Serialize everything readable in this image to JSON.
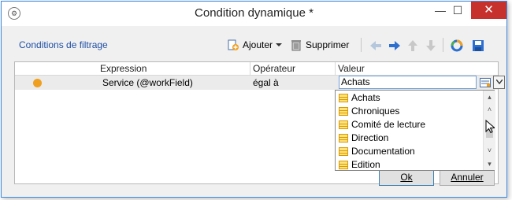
{
  "window": {
    "title": "Condition dynamique *",
    "app_icon": "window-icon",
    "minimize_glyph": "—",
    "maximize_glyph": "☐",
    "close_glyph": "✕"
  },
  "toolbar": {
    "section_label": "Conditions de filtrage",
    "add_label": "Ajouter",
    "delete_label": "Supprimer"
  },
  "grid": {
    "columns": [
      "Expression",
      "Opérateur",
      "Valeur"
    ],
    "rows": [
      {
        "expression": "Service (@workField)",
        "operator": "égal à",
        "value": "Achats"
      }
    ]
  },
  "dropdown": {
    "items": [
      "Achats",
      "Chroniques",
      "Comité de lecture",
      "Direction",
      "Documentation",
      "Edition"
    ]
  },
  "buttons": {
    "ok": "Ok",
    "cancel": "Annuler"
  },
  "colors": {
    "accent": "#3c8be5",
    "close": "#c7312d",
    "row_status": "#f0a020",
    "link": "#1f4fa6"
  }
}
